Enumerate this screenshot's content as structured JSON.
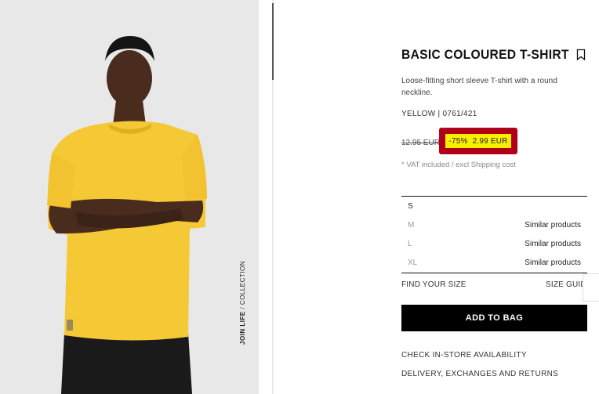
{
  "photo": {
    "alt_subject": "model-in-yellow-tshirt",
    "vertical_label_bold": "JOIN LIFE",
    "vertical_label_sep": " / ",
    "vertical_label_rest": "COLLECTION"
  },
  "product": {
    "title": "BASIC COLOURED T-SHIRT",
    "description": "Loose-fitting short sleeve T-shirt with a round neckline.",
    "color_ref": "YELLOW | 0761/421",
    "old_price": "12.95 EUR",
    "discount": "-75%",
    "sale_price": "2.99 EUR",
    "vat_note": "* VAT included / excl Shipping cost"
  },
  "sizes": [
    {
      "label": "S",
      "available": true,
      "note": ""
    },
    {
      "label": "M",
      "available": false,
      "note": "Similar products"
    },
    {
      "label": "L",
      "available": false,
      "note": "Similar products"
    },
    {
      "label": "XL",
      "available": false,
      "note": "Similar products"
    }
  ],
  "actions": {
    "find_size": "FIND YOUR SIZE",
    "size_guide": "SIZE GUIDE",
    "add_to_bag": "ADD TO BAG",
    "store_availability": "CHECK IN-STORE AVAILABILITY",
    "delivery": "DELIVERY, EXCHANGES AND RETURNS"
  },
  "icons": {
    "bookmark": "bookmark-icon"
  },
  "colors": {
    "highlight_border": "#b00018",
    "highlight_fill": "#f8f000",
    "shirt": "#f5c935",
    "button": "#000000"
  }
}
